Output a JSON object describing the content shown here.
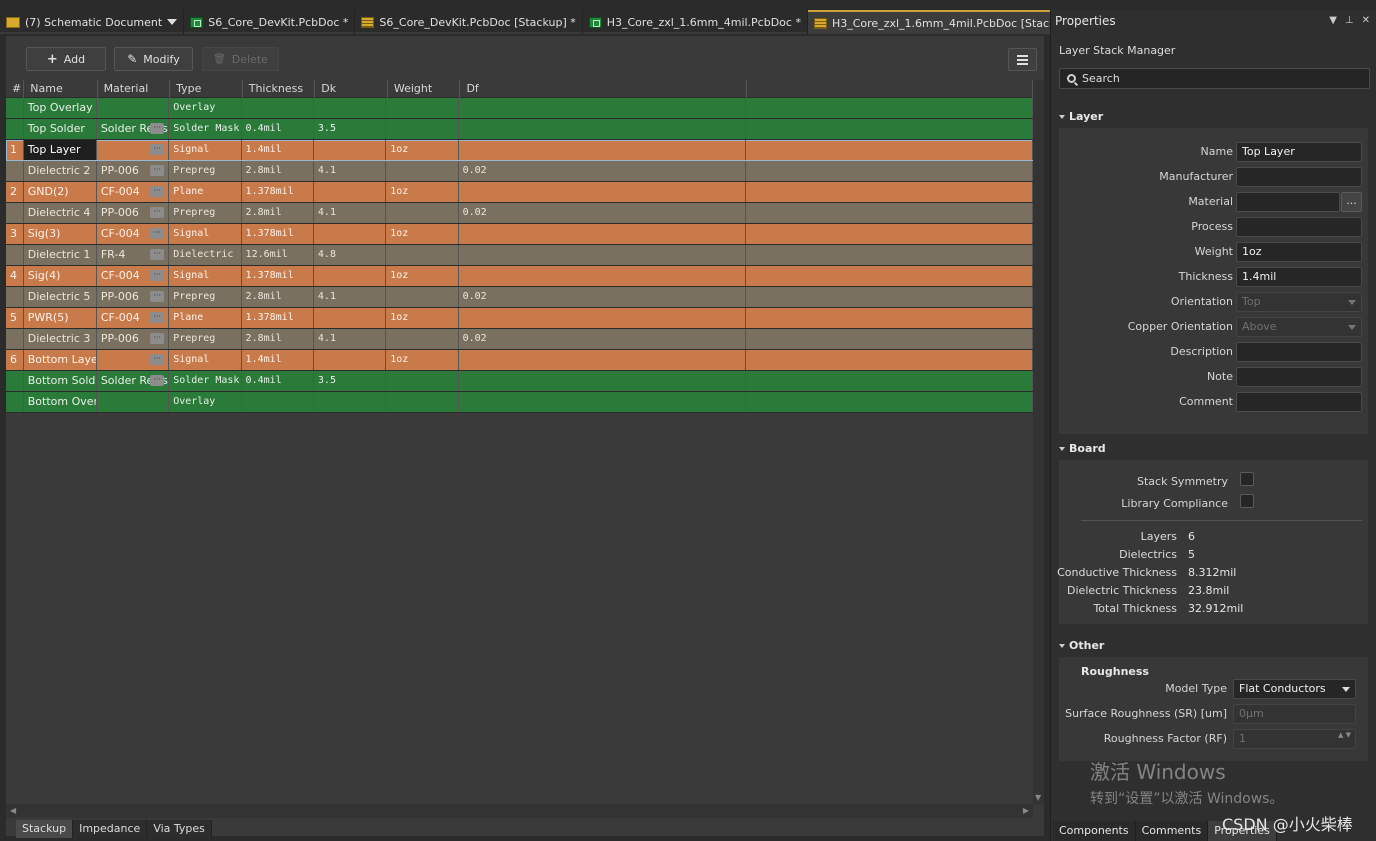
{
  "tabs": [
    {
      "label": "(7) Schematic Document",
      "icon": "document-icon",
      "caret": true
    },
    {
      "label": "S6_Core_DevKit.PcbDoc *",
      "icon": "pcb-icon"
    },
    {
      "label": "S6_Core_DevKit.PcbDoc [Stackup] *",
      "icon": "stackup-icon"
    },
    {
      "label": "H3_Core_zxl_1.6mm_4mil.PcbDoc *",
      "icon": "pcb-icon"
    },
    {
      "label": "H3_Core_zxl_1.6mm_4mil.PcbDoc [Stackup] *",
      "icon": "stackup-icon",
      "active": true
    }
  ],
  "toolbar": {
    "add": "Add",
    "modify": "Modify",
    "delete": "Delete"
  },
  "grid": {
    "columns": [
      "#",
      "Name",
      "Material",
      "Type",
      "Thickness",
      "Dk",
      "Weight",
      "Df"
    ],
    "rows": [
      {
        "num": "",
        "name": "Top Overlay",
        "material": "",
        "type": "Overlay",
        "thickness": "",
        "dk": "",
        "weight": "",
        "df": "",
        "kind": "solder",
        "ellipsis": false
      },
      {
        "num": "",
        "name": "Top Solder",
        "material": "Solder Resist",
        "type": "Solder Mask",
        "thickness": "0.4mil",
        "dk": "3.5",
        "weight": "",
        "df": "",
        "kind": "solder",
        "ellipsis": true
      },
      {
        "num": "1",
        "name": "Top Layer",
        "material": "",
        "type": "Signal",
        "thickness": "1.4mil",
        "dk": "",
        "weight": "1oz",
        "df": "",
        "kind": "copper",
        "ellipsis": true,
        "selected": true
      },
      {
        "num": "",
        "name": "Dielectric 2",
        "material": "PP-006",
        "type": "Prepreg",
        "thickness": "2.8mil",
        "dk": "4.1",
        "weight": "",
        "df": "0.02",
        "kind": "diel",
        "ellipsis": true
      },
      {
        "num": "2",
        "name": "GND(2)",
        "material": "CF-004",
        "type": "Plane",
        "thickness": "1.378mil",
        "dk": "",
        "weight": "1oz",
        "df": "",
        "kind": "copper",
        "ellipsis": true
      },
      {
        "num": "",
        "name": "Dielectric 4",
        "material": "PP-006",
        "type": "Prepreg",
        "thickness": "2.8mil",
        "dk": "4.1",
        "weight": "",
        "df": "0.02",
        "kind": "diel",
        "ellipsis": true
      },
      {
        "num": "3",
        "name": "Sig(3)",
        "material": "CF-004",
        "type": "Signal",
        "thickness": "1.378mil",
        "dk": "",
        "weight": "1oz",
        "df": "",
        "kind": "copper",
        "ellipsis": true
      },
      {
        "num": "",
        "name": "Dielectric 1",
        "material": "FR-4",
        "type": "Dielectric",
        "thickness": "12.6mil",
        "dk": "4.8",
        "weight": "",
        "df": "",
        "kind": "diel",
        "ellipsis": true
      },
      {
        "num": "4",
        "name": "Sig(4)",
        "material": "CF-004",
        "type": "Signal",
        "thickness": "1.378mil",
        "dk": "",
        "weight": "1oz",
        "df": "",
        "kind": "copper",
        "ellipsis": true
      },
      {
        "num": "",
        "name": "Dielectric 5",
        "material": "PP-006",
        "type": "Prepreg",
        "thickness": "2.8mil",
        "dk": "4.1",
        "weight": "",
        "df": "0.02",
        "kind": "diel",
        "ellipsis": true
      },
      {
        "num": "5",
        "name": "PWR(5)",
        "material": "CF-004",
        "type": "Plane",
        "thickness": "1.378mil",
        "dk": "",
        "weight": "1oz",
        "df": "",
        "kind": "copper",
        "ellipsis": true
      },
      {
        "num": "",
        "name": "Dielectric 3",
        "material": "PP-006",
        "type": "Prepreg",
        "thickness": "2.8mil",
        "dk": "4.1",
        "weight": "",
        "df": "0.02",
        "kind": "diel",
        "ellipsis": true
      },
      {
        "num": "6",
        "name": "Bottom Layer",
        "material": "",
        "type": "Signal",
        "thickness": "1.4mil",
        "dk": "",
        "weight": "1oz",
        "df": "",
        "kind": "copper",
        "ellipsis": true
      },
      {
        "num": "",
        "name": "Bottom Solder",
        "material": "Solder Resist",
        "type": "Solder Mask",
        "thickness": "0.4mil",
        "dk": "3.5",
        "weight": "",
        "df": "",
        "kind": "solder",
        "ellipsis": true
      },
      {
        "num": "",
        "name": "Bottom Overlay",
        "material": "",
        "type": "Overlay",
        "thickness": "",
        "dk": "",
        "weight": "",
        "df": "",
        "kind": "solder",
        "ellipsis": false
      }
    ]
  },
  "bottom_tabs": [
    "Stackup",
    "Impedance",
    "Via Types"
  ],
  "panel": {
    "title": "Properties",
    "subtitle": "Layer Stack Manager",
    "search_placeholder": "Search",
    "layer_section": "Layer",
    "layer_props": [
      {
        "label": "Name",
        "value": "Top Layer"
      },
      {
        "label": "Manufacturer",
        "value": ""
      },
      {
        "label": "Material",
        "value": "",
        "button": "..."
      },
      {
        "label": "Process",
        "value": ""
      },
      {
        "label": "Weight",
        "value": "1oz"
      },
      {
        "label": "Thickness",
        "value": "1.4mil"
      },
      {
        "label": "Orientation",
        "value": "Top",
        "disabled": true,
        "dropdown": true
      },
      {
        "label": "Copper Orientation",
        "value": "Above",
        "disabled": true,
        "dropdown": true
      },
      {
        "label": "Description",
        "value": ""
      },
      {
        "label": "Note",
        "value": ""
      },
      {
        "label": "Comment",
        "value": ""
      }
    ],
    "board_section": "Board",
    "board_checks": [
      {
        "label": "Stack Symmetry",
        "checked": false
      },
      {
        "label": "Library Compliance",
        "checked": false
      }
    ],
    "board_stats": [
      {
        "label": "Layers",
        "value": "6"
      },
      {
        "label": "Dielectrics",
        "value": "5"
      },
      {
        "label": "Conductive Thickness",
        "value": "8.312mil"
      },
      {
        "label": "Dielectric Thickness",
        "value": "23.8mil"
      },
      {
        "label": "Total Thickness",
        "value": "32.912mil"
      }
    ],
    "other_section": "Other",
    "roughness_title": "Roughness",
    "roughness": [
      {
        "label": "Model Type",
        "value": "Flat Conductors",
        "dropdown": true
      },
      {
        "label": "Surface Roughness (SR) [um]",
        "value": "0μm",
        "disabled": true
      },
      {
        "label": "Roughness Factor (RF)",
        "value": "1",
        "disabled": true,
        "spin": true
      }
    ],
    "tabs": [
      "Components",
      "Comments",
      "Properties"
    ],
    "active_tab": "Properties"
  },
  "watermark": {
    "line1": "激活 Windows",
    "line2": "转到“设置”以激活 Windows。"
  },
  "credit": "CSDN @小火柴棒",
  "colors": {
    "solder": "#2a7a3a",
    "copper": "#c87a4a",
    "dielectric": "#7a7060",
    "accent": "#c9a23a"
  }
}
